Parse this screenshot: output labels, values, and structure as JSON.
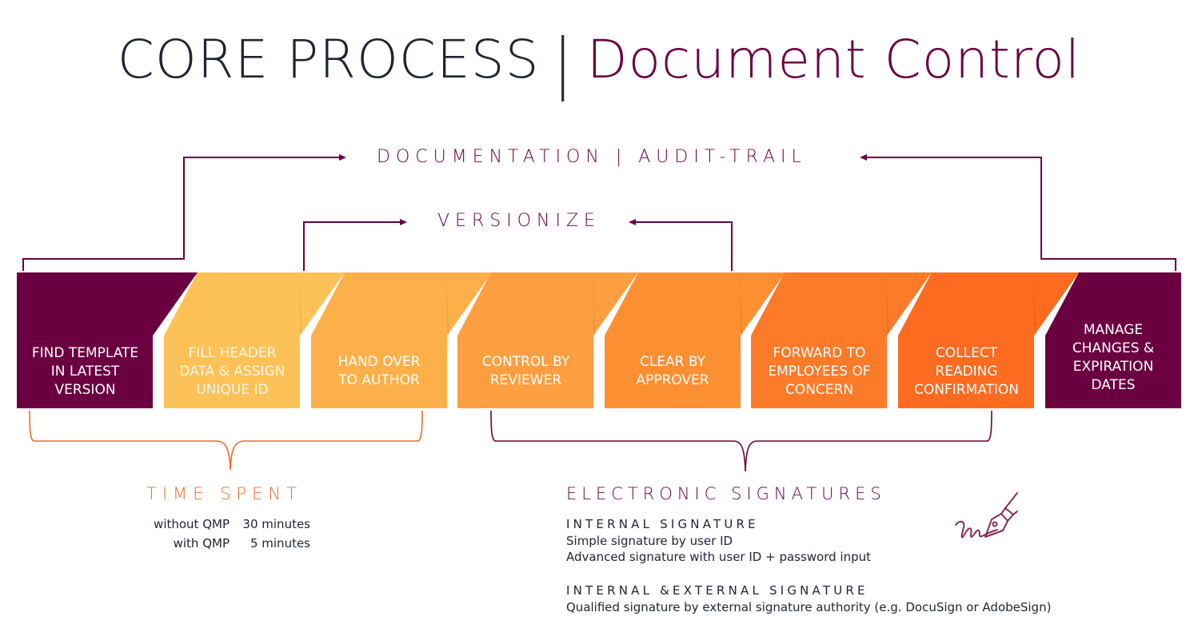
{
  "title": {
    "part1": "CORE PROCESS",
    "separator": "|",
    "part2": "Document Control"
  },
  "colors": {
    "maroon": "#6b0040",
    "dark_text": "#1f2433",
    "orange_accent": "#f26a2a",
    "step_colors": [
      "#6b0040",
      "#fdc257",
      "#fdb04a",
      "#fd9f40",
      "#fd8f33",
      "#fd7a28",
      "#fc6b1f",
      "#6b0040"
    ]
  },
  "loops": {
    "documentation": "DOCUMENTATION | AUDIT-TRAIL",
    "versionize": "VERSIONIZE"
  },
  "steps": [
    {
      "label": "FIND TEMPLATE\nIN LATEST\nVERSION"
    },
    {
      "label": "FILL HEADER\nDATA & ASSIGN\nUNIQUE ID"
    },
    {
      "label": "HAND OVER\nTO AUTHOR"
    },
    {
      "label": "CONTROL BY\nREVIEWER"
    },
    {
      "label": "CLEAR BY\nAPPROVER"
    },
    {
      "label": "FORWARD TO\nEMPLOYEES OF\nCONCERN"
    },
    {
      "label": "COLLECT\nREADING\nCONFIRMATION"
    },
    {
      "label": "MANAGE\nCHANGES &\nEXPIRATION\nDATES"
    }
  ],
  "time_spent": {
    "title": "TIME SPENT",
    "rows": [
      {
        "label": "without QMP",
        "value": "30 minutes"
      },
      {
        "label": "with QMP",
        "value": "5 minutes"
      }
    ]
  },
  "signatures": {
    "title": "ELECTRONIC SIGNATURES",
    "icon": "signature-pen-icon",
    "internal": {
      "heading": "INTERNAL SIGNATURE",
      "lines": [
        "Simple signature by user ID",
        "Advanced signature with user ID + password input"
      ]
    },
    "external": {
      "heading": "INTERNAL &EXTERNAL SIGNATURE",
      "lines": [
        "Qualified signature by external signature authority (e.g. DocuSign or AdobeSign)"
      ]
    }
  }
}
